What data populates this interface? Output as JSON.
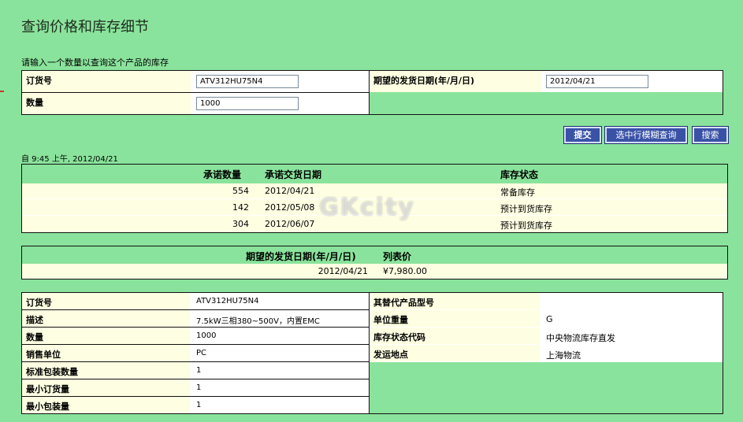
{
  "page": {
    "title": "查询价格和库存细节",
    "instruction": "请输入一个数量以查询这个产品的库存"
  },
  "query_form": {
    "order_no_label": "订货号",
    "order_no_value": "ATV312HU75N4",
    "quantity_label": "数量",
    "quantity_value": "1000",
    "ship_date_label": "期望的发货日期(年/月/日)",
    "ship_date_value": "2012/04/21"
  },
  "actions": {
    "submit": "提交",
    "fuzzy_query": "选中行模糊查询",
    "search": "搜索"
  },
  "since_text": "自 9:45 上午, 2012/04/21",
  "availability": {
    "headers": [
      "承诺数量",
      "承诺交货日期",
      "库存状态"
    ],
    "rows": [
      {
        "qty": "554",
        "date": "2012/04/21",
        "status": "常备库存"
      },
      {
        "qty": "142",
        "date": "2012/05/08",
        "status": "预计到货库存"
      },
      {
        "qty": "304",
        "date": "2012/06/07",
        "status": "预计到货库存"
      }
    ]
  },
  "watermark": "GKcity",
  "price": {
    "headers": [
      "期望的发货日期(年/月/日)",
      "列表价"
    ],
    "date": "2012/04/21",
    "value": "¥7,980.00"
  },
  "details_left": [
    {
      "label": "订货号",
      "value": "ATV312HU75N4"
    },
    {
      "label": "描述",
      "value": "7.5kW三相380~500V，内置EMC"
    },
    {
      "label": "数量",
      "value": "1000"
    },
    {
      "label": "销售单位",
      "value": "PC"
    },
    {
      "label": "标准包装数量",
      "value": "1"
    },
    {
      "label": "最小订货量",
      "value": "1"
    },
    {
      "label": "最小包装量",
      "value": "1"
    }
  ],
  "details_right": [
    {
      "label": "其替代产品型号",
      "value": ""
    },
    {
      "label": "单位重量",
      "value": "G"
    },
    {
      "label": "库存状态代码",
      "value": "中央物流库存直发"
    },
    {
      "label": "发运地点",
      "value": "上海物流"
    }
  ]
}
